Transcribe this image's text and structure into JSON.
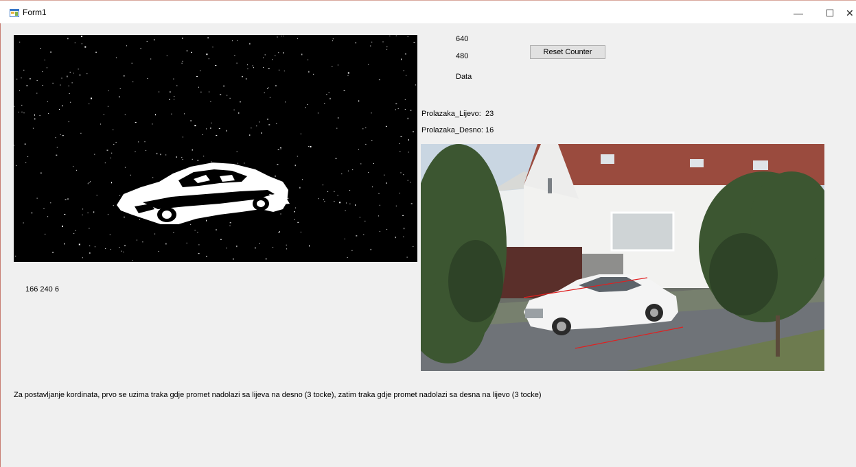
{
  "window": {
    "title": "Form1",
    "minimize_glyph": "—",
    "maximize_glyph": "☐",
    "close_glyph": "✕"
  },
  "labels": {
    "width_value": "640",
    "height_value": "480",
    "data_label": "Data",
    "left_count_label": "Prolazaka_Lijevo:",
    "left_count_value": "23",
    "right_count_label": "Prolazaka_Desno:",
    "right_count_value": "16",
    "coords_readout": "166 240 6",
    "instructions": "Za postavljanje kordinata, prvo se uzima traka gdje promet nadolazi sa lijeva na desno (3 tocke), zatim traka gdje promet nadolazi sa desna na lijevo (3 tocke)"
  },
  "buttons": {
    "reset_counter": "Reset Counter"
  },
  "colors": {
    "client_background": "#f0f0f0",
    "lane_line": "#e02020"
  },
  "icons": {
    "app": "form-app-icon",
    "minimize": "minimize-icon",
    "maximize": "maximize-icon",
    "close": "close-icon"
  }
}
